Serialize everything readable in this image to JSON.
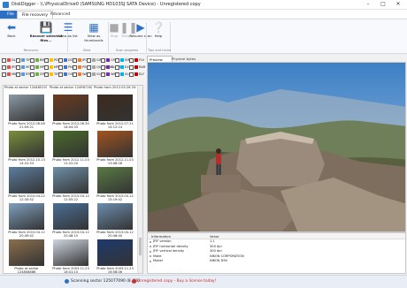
{
  "window": {
    "title": "DiskDigger - \\\\.\\PhysicalDrive0 (SAMSUNG HD103SJ SATA Device) - Unregistered copy",
    "controls": [
      "minimize-icon",
      "maximize-icon",
      "close-icon"
    ]
  },
  "ribbon_tabs": [
    {
      "label": "File"
    },
    {
      "label": "File recovery"
    },
    {
      "label": "Advanced"
    }
  ],
  "ribbon": {
    "back": {
      "label": "Back",
      "icon": "back-arrow-icon"
    },
    "recover": {
      "label": "Recover selected files...",
      "icon": "recover-icon"
    },
    "view_list": {
      "label": "View as list",
      "icon": "list-view-icon"
    },
    "view_thumbs": {
      "label": "View as thumbnails",
      "icon": "thumbnail-view-icon"
    },
    "stop": {
      "label": "Stop",
      "icon": "stop-icon"
    },
    "pause": {
      "label": "Pause",
      "icon": "pause-icon"
    },
    "resume": {
      "label": "Resume scan",
      "icon": "resume-icon"
    },
    "help": {
      "label": "Help",
      "icon": "help-icon"
    },
    "groups": [
      "Recovery",
      "View",
      "Scan progress",
      "Tips and tricks"
    ]
  },
  "filters": {
    "items": [
      "DLL",
      "TIF",
      "BMP",
      "PDF",
      "DOC",
      "JPG",
      "GIF",
      "CR2",
      "EMF",
      "FLV",
      "JPG",
      "MOV",
      "MP3",
      "MP4",
      "PNG",
      "PSD",
      "QUICKTIME",
      "CLASS",
      "EXE",
      "RAR",
      "MID",
      "RTF",
      "ZIP",
      "TIFF",
      "CHM",
      "WAV",
      "VLC",
      "WMA",
      "XLS",
      "ELF"
    ],
    "colors": [
      "#d9534f",
      "#5b9bd5",
      "#70ad47",
      "#ffc000",
      "#4472c4",
      "#ed7d31",
      "#a5a5a5",
      "#7030a0",
      "#00b0f0",
      "#c00000"
    ]
  },
  "thumbnails": {
    "top_row": [
      "Photo at sector 1244851516",
      "Photo at sector 124967162",
      "Photo from 2012.05.26 20:..."
    ],
    "items": [
      {
        "caption": "Photo from 2012.08.08 21:09:21",
        "color": "#8a9aa6"
      },
      {
        "caption": "Photo from 2012.06.30 18:04:33",
        "color": "#6b3a1e"
      },
      {
        "caption": "Photo from 2012.07.21 14:12:14",
        "color": "#3c2a1d"
      },
      {
        "caption": "Photo from 2012.10.13 14:22:53",
        "color": "#7a8f3c"
      },
      {
        "caption": "Photo from 2012.11.03 12:22:20",
        "color": "#4a6b2a"
      },
      {
        "caption": "Photo from 2012.11.03 13:08:28",
        "color": "#a4541f"
      },
      {
        "caption": "Photo from 2015.04.22 12:34:52",
        "color": "#5c7d9e"
      },
      {
        "caption": "Photo from 2015.04.12 12:55:22",
        "color": "#6e8fa8"
      },
      {
        "caption": "Photo from 2015.04.12 15:19:42",
        "color": "#5a7a45"
      },
      {
        "caption": "Photo from 2015.04.12 20:49:42",
        "color": "#7fa0bf"
      },
      {
        "caption": "Photo from 2015.04.12 20:48:15",
        "color": "#4a6f96"
      },
      {
        "caption": "Photo from 2015.04.12 20:46:40",
        "color": "#6c8dae"
      },
      {
        "caption": "Photo at sector 124808886",
        "color": "#8b6f4e"
      },
      {
        "caption": "Photo from 2003.11.23 16:41:15",
        "color": "#cfd6e0"
      },
      {
        "caption": "Photo from 2003.11.23 16:58:06",
        "color": "#1d3a6e"
      }
    ]
  },
  "preview": {
    "tabs": [
      "Preview",
      "Physical bytes"
    ],
    "sky": "#4f8fcf",
    "rock": "#8c7a6b"
  },
  "info": {
    "columns": [
      "Information",
      "Value"
    ],
    "rows": [
      {
        "k": "JFIF version",
        "v": "1.1"
      },
      {
        "k": "JFIF horizontal density",
        "v": "300 dpi"
      },
      {
        "k": "JFIF vertical density",
        "v": "300 dpi"
      },
      {
        "k": "Make",
        "v": "NIKON CORPORATION"
      },
      {
        "k": "Model",
        "v": "NIKON D90"
      }
    ]
  },
  "status": {
    "scan": "Scanning sector 125077090 (8.4%)",
    "license": "Unregistered copy - Buy a license today!"
  }
}
